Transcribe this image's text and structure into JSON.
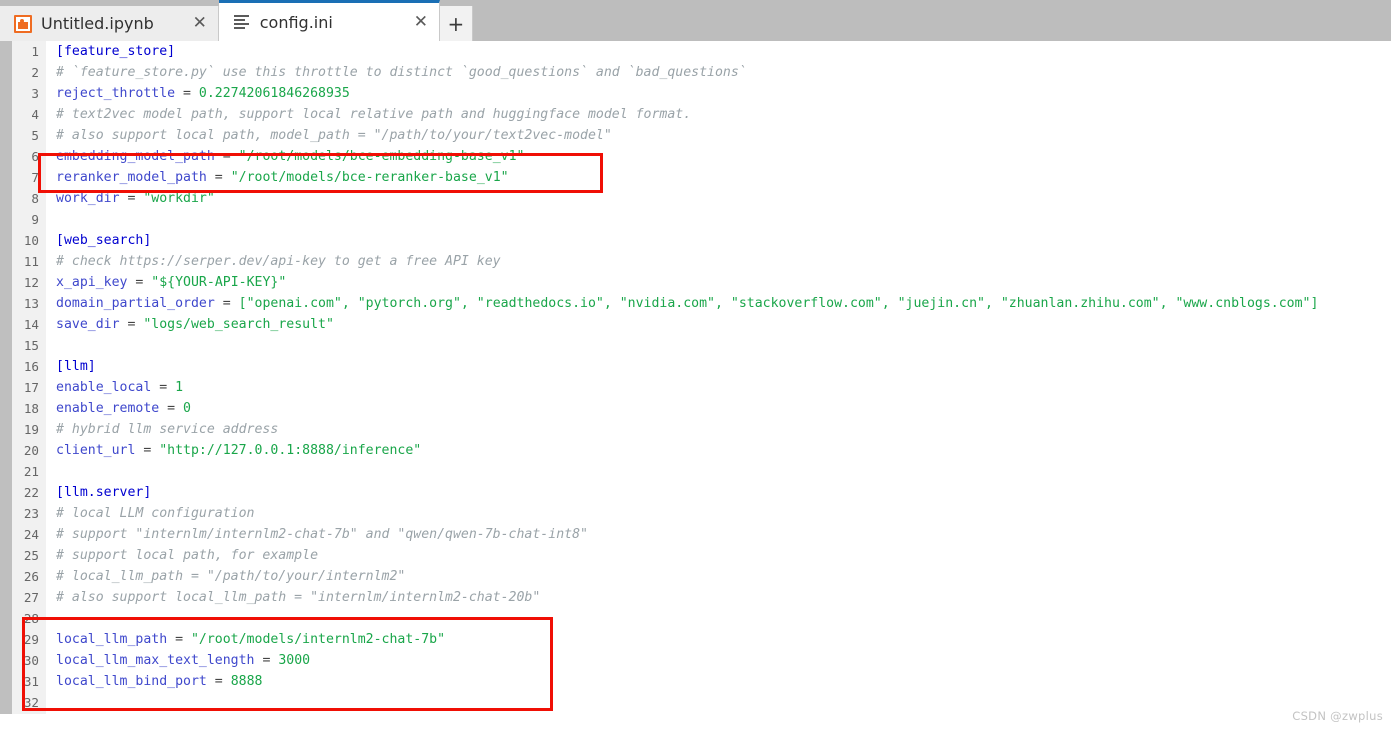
{
  "window": {
    "tabs": [
      {
        "label": "Untitled.ipynb",
        "icon": "notebook-icon",
        "active": false,
        "close_glyph": "✕"
      },
      {
        "label": "config.ini",
        "icon": "text-file-icon",
        "active": true,
        "close_glyph": "✕"
      }
    ],
    "new_tab_glyph": "+"
  },
  "editor": {
    "file_name": "config.ini",
    "language": "ini",
    "lines": [
      {
        "n": "1",
        "tokens": [
          {
            "t": "section",
            "s": "[feature_store]"
          }
        ]
      },
      {
        "n": "2",
        "tokens": [
          {
            "t": "comment",
            "s": "# `feature_store.py` use this throttle to distinct `good_questions` and `bad_questions`"
          }
        ]
      },
      {
        "n": "3",
        "tokens": [
          {
            "t": "key",
            "s": "reject_throttle"
          },
          {
            "t": "eq",
            "s": " = "
          },
          {
            "t": "num",
            "s": "0.22742061846268935"
          }
        ]
      },
      {
        "n": "4",
        "tokens": [
          {
            "t": "comment",
            "s": "# text2vec model path, support local relative path and huggingface model format."
          }
        ]
      },
      {
        "n": "5",
        "tokens": [
          {
            "t": "comment",
            "s": "# also support local path, model_path = \"/path/to/your/text2vec-model\""
          }
        ]
      },
      {
        "n": "6",
        "tokens": [
          {
            "t": "key",
            "s": "embedding_model_path"
          },
          {
            "t": "eq",
            "s": " = "
          },
          {
            "t": "val",
            "s": "\"/root/models/bce-embedding-base_v1\""
          }
        ]
      },
      {
        "n": "7",
        "tokens": [
          {
            "t": "key",
            "s": "reranker_model_path"
          },
          {
            "t": "eq",
            "s": " = "
          },
          {
            "t": "val",
            "s": "\"/root/models/bce-reranker-base_v1\""
          }
        ]
      },
      {
        "n": "8",
        "tokens": [
          {
            "t": "key",
            "s": "work_dir"
          },
          {
            "t": "eq",
            "s": " = "
          },
          {
            "t": "val",
            "s": "\"workdir\""
          }
        ]
      },
      {
        "n": "9",
        "tokens": []
      },
      {
        "n": "10",
        "tokens": [
          {
            "t": "section",
            "s": "[web_search]"
          }
        ]
      },
      {
        "n": "11",
        "tokens": [
          {
            "t": "comment",
            "s": "# check https://serper.dev/api-key to get a free API key"
          }
        ]
      },
      {
        "n": "12",
        "tokens": [
          {
            "t": "key",
            "s": "x_api_key"
          },
          {
            "t": "eq",
            "s": " = "
          },
          {
            "t": "val",
            "s": "\"${YOUR-API-KEY}\""
          }
        ]
      },
      {
        "n": "13",
        "tokens": [
          {
            "t": "key",
            "s": "domain_partial_order"
          },
          {
            "t": "eq",
            "s": " = "
          },
          {
            "t": "val",
            "s": "[\"openai.com\", \"pytorch.org\", \"readthedocs.io\", \"nvidia.com\", \"stackoverflow.com\", \"juejin.cn\", \"zhuanlan.zhihu.com\", \"www.cnblogs.com\"]"
          }
        ]
      },
      {
        "n": "14",
        "tokens": [
          {
            "t": "key",
            "s": "save_dir"
          },
          {
            "t": "eq",
            "s": " = "
          },
          {
            "t": "val",
            "s": "\"logs/web_search_result\""
          }
        ]
      },
      {
        "n": "15",
        "tokens": []
      },
      {
        "n": "16",
        "tokens": [
          {
            "t": "section",
            "s": "[llm]"
          }
        ]
      },
      {
        "n": "17",
        "tokens": [
          {
            "t": "key",
            "s": "enable_local"
          },
          {
            "t": "eq",
            "s": " = "
          },
          {
            "t": "num",
            "s": "1"
          }
        ]
      },
      {
        "n": "18",
        "tokens": [
          {
            "t": "key",
            "s": "enable_remote"
          },
          {
            "t": "eq",
            "s": " = "
          },
          {
            "t": "num",
            "s": "0"
          }
        ]
      },
      {
        "n": "19",
        "tokens": [
          {
            "t": "comment",
            "s": "# hybrid llm service address"
          }
        ]
      },
      {
        "n": "20",
        "tokens": [
          {
            "t": "key",
            "s": "client_url"
          },
          {
            "t": "eq",
            "s": " = "
          },
          {
            "t": "val",
            "s": "\"http://127.0.0.1:8888/inference\""
          }
        ]
      },
      {
        "n": "21",
        "tokens": []
      },
      {
        "n": "22",
        "tokens": [
          {
            "t": "section",
            "s": "[llm.server]"
          }
        ]
      },
      {
        "n": "23",
        "tokens": [
          {
            "t": "comment",
            "s": "# local LLM configuration"
          }
        ]
      },
      {
        "n": "24",
        "tokens": [
          {
            "t": "comment",
            "s": "# support \"internlm/internlm2-chat-7b\" and \"qwen/qwen-7b-chat-int8\""
          }
        ]
      },
      {
        "n": "25",
        "tokens": [
          {
            "t": "comment",
            "s": "# support local path, for example"
          }
        ]
      },
      {
        "n": "26",
        "tokens": [
          {
            "t": "comment",
            "s": "# local_llm_path = \"/path/to/your/internlm2\""
          }
        ]
      },
      {
        "n": "27",
        "tokens": [
          {
            "t": "comment",
            "s": "# also support local_llm_path = \"internlm/internlm2-chat-20b\""
          }
        ]
      },
      {
        "n": "28",
        "tokens": []
      },
      {
        "n": "29",
        "tokens": [
          {
            "t": "key",
            "s": "local_llm_path"
          },
          {
            "t": "eq",
            "s": " = "
          },
          {
            "t": "val",
            "s": "\"/root/models/internlm2-chat-7b\""
          }
        ]
      },
      {
        "n": "30",
        "tokens": [
          {
            "t": "key",
            "s": "local_llm_max_text_length"
          },
          {
            "t": "eq",
            "s": " = "
          },
          {
            "t": "num",
            "s": "3000"
          }
        ]
      },
      {
        "n": "31",
        "tokens": [
          {
            "t": "key",
            "s": "local_llm_bind_port"
          },
          {
            "t": "eq",
            "s": " = "
          },
          {
            "t": "num",
            "s": "8888"
          }
        ]
      },
      {
        "n": "32",
        "tokens": []
      }
    ]
  },
  "annotations": [
    {
      "name": "model-path-highlight",
      "covers_lines": [
        "6",
        "7"
      ],
      "color": "#f00f05"
    },
    {
      "name": "local-llm-highlight",
      "covers_lines": [
        "28",
        "29",
        "30",
        "31",
        "32"
      ],
      "color": "#f00f05"
    }
  ],
  "watermark": {
    "text": "CSDN @zwplus"
  },
  "colors": {
    "comment": "#9aa3a8",
    "section": "#0000d0",
    "key": "#3f48cc",
    "value": "#1aa64a",
    "number": "#1aa64a",
    "annotation": "#f00f05",
    "tabbar_background": "#bdbdbd",
    "active_tab_accent": "#1a6fb5"
  }
}
